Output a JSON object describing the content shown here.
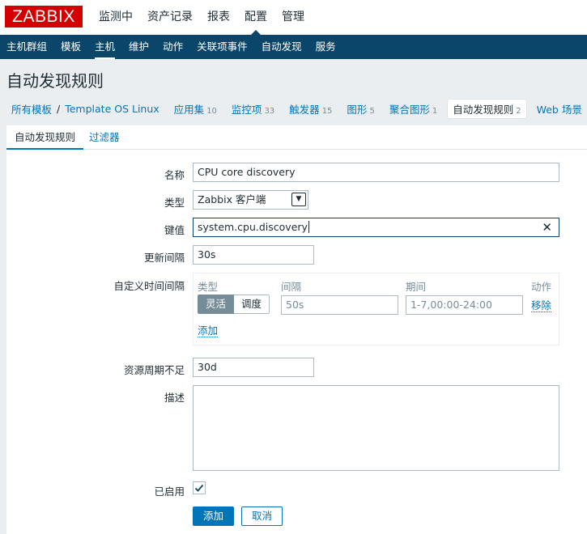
{
  "brand": {
    "logo_text": "ZABBIX",
    "color": "#d40000"
  },
  "top_nav": [
    "监测中",
    "资产记录",
    "报表",
    "配置",
    "管理"
  ],
  "top_nav_active": "配置",
  "sub_nav": [
    "主机群组",
    "模板",
    "主机",
    "维护",
    "动作",
    "关联项事件",
    "自动发现",
    "服务"
  ],
  "sub_nav_active": "主机",
  "page_title": "自动发现规则",
  "host_nav": {
    "all_templates": "所有模板",
    "separator": "/",
    "template": "Template OS Linux",
    "items": [
      {
        "label": "应用集",
        "count": "10"
      },
      {
        "label": "监控项",
        "count": "33"
      },
      {
        "label": "触发器",
        "count": "15"
      },
      {
        "label": "图形",
        "count": "5"
      },
      {
        "label": "聚合图形",
        "count": "1"
      },
      {
        "label": "自动发现规则",
        "count": "2"
      },
      {
        "label": "Web 场景",
        "count": ""
      }
    ]
  },
  "tabs": [
    "自动发现规则",
    "过滤器"
  ],
  "form": {
    "name_label": "名称",
    "name_value": "CPU core discovery",
    "type_label": "类型",
    "type_value": "Zabbix 客户端",
    "key_label": "键值",
    "key_value": "system.cpu.discovery",
    "interval_label": "更新间隔",
    "interval_value": "30s",
    "custom_label": "自定义时间间隔",
    "custom": {
      "col_type": "类型",
      "col_interval": "间隔",
      "col_period": "期间",
      "col_action": "动作",
      "flexible": "灵活",
      "scheduling": "调度",
      "interval_placeholder": "50s",
      "period_placeholder": "1-7,00:00-24:00",
      "remove": "移除",
      "add": "添加"
    },
    "lifetime_label": "资源周期不足",
    "lifetime_value": "30d",
    "desc_label": "描述",
    "enabled_label": "已启用",
    "add_button": "添加",
    "cancel_button": "取消"
  },
  "colors": {
    "header_blue": "#0a466a",
    "link_blue": "#0275b8",
    "page_bg": "#ebeef0"
  }
}
